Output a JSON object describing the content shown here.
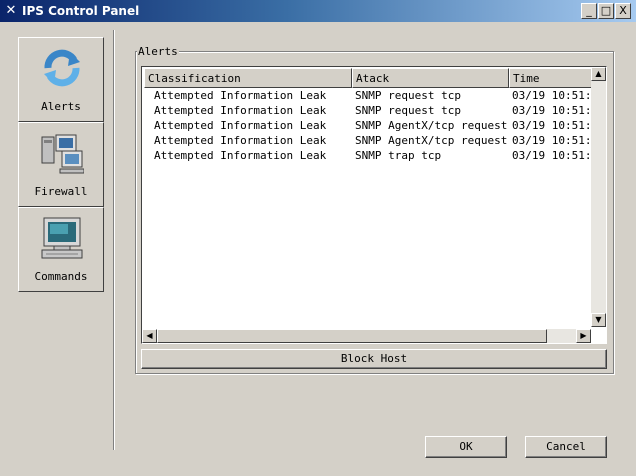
{
  "window": {
    "title": "IPS Control Panel"
  },
  "titlebar_buttons": {
    "minimize": "_",
    "maximize": "□",
    "close": "X"
  },
  "nav": {
    "items": [
      {
        "label": "Alerts",
        "icon": "refresh-arrows-icon"
      },
      {
        "label": "Firewall",
        "icon": "firewall-computers-icon"
      },
      {
        "label": "Commands",
        "icon": "computer-terminal-icon"
      }
    ]
  },
  "alerts": {
    "group_title": "Alerts",
    "columns": [
      "Classification",
      "Atack",
      "Time"
    ],
    "rows": [
      [
        "Attempted Information Leak",
        "SNMP request tcp",
        "03/19 10:51:"
      ],
      [
        "Attempted Information Leak",
        "SNMP request tcp",
        "03/19 10:51:"
      ],
      [
        "Attempted Information Leak",
        "SNMP AgentX/tcp request",
        "03/19 10:51:"
      ],
      [
        "Attempted Information Leak",
        "SNMP AgentX/tcp request",
        "03/19 10:51:"
      ],
      [
        "Attempted Information Leak",
        "SNMP trap tcp",
        "03/19 10:51:"
      ]
    ]
  },
  "buttons": {
    "block_host": "Block Host",
    "ok": "OK",
    "cancel": "Cancel"
  }
}
